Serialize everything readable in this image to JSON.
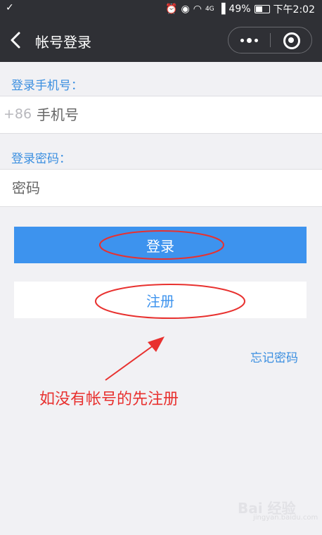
{
  "status_bar": {
    "battery": "49%",
    "time": "下午2:02",
    "network": "4G"
  },
  "nav": {
    "title": "帐号登录"
  },
  "form": {
    "phone_label": "登录手机号：",
    "country_code": "+86",
    "phone_placeholder": "手机号",
    "password_label": "登录密码：",
    "password_placeholder": "密码"
  },
  "buttons": {
    "login": "登录",
    "register": "注册",
    "forgot": "忘记密码"
  },
  "annotation": {
    "text": "如没有帐号的先注册",
    "color": "#e8312f"
  },
  "watermark": {
    "brand": "Bai 经验",
    "sub": "jingyan.baidu.com"
  },
  "colors": {
    "accent": "#3d93ee",
    "navbar": "#2f3035",
    "background": "#f1f1f4"
  }
}
